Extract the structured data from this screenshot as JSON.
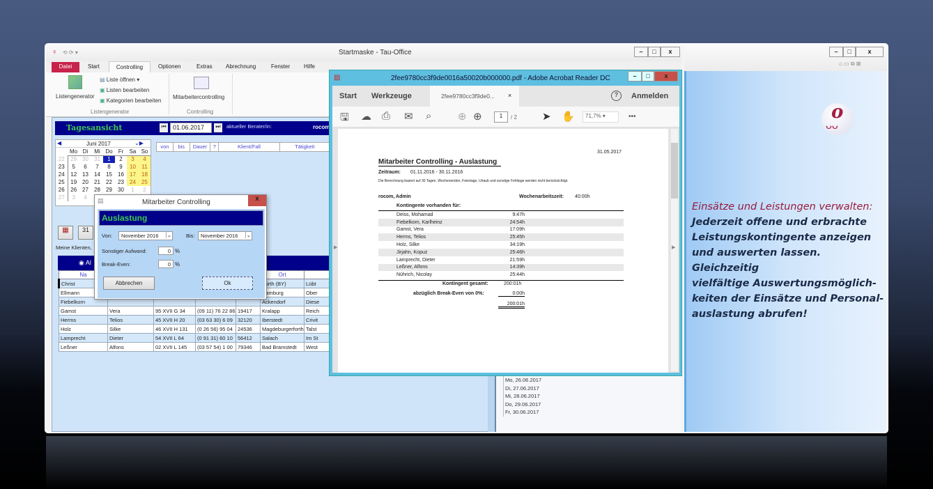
{
  "app": {
    "title": "Startmaske - Tau-Office",
    "quick_access": "⟲ ⟳ ▾",
    "tabs": [
      "Datei",
      "Start",
      "Controlling",
      "Optionen",
      "Extras",
      "Abrechnung",
      "Fenster",
      "Hilfe"
    ],
    "ribbon": {
      "listengenerator": "Listengenerator",
      "liste_oeffnen": "Liste öffnen ▾",
      "listen_bearbeiten": "Listen bearbeiten",
      "kategorien_bearbeiten": "Kategorien bearbeiten",
      "group1": "Listengenerator",
      "mitarbeitercontrolling": "Mitarbeitercontrolling",
      "group2": "Controlling"
    },
    "day_view": {
      "title": "Tagesansicht",
      "date": "01.06.2017",
      "berater_label": "aktueller Berater/in:",
      "berater": "rocom"
    },
    "calendar": {
      "month": "Juni 2017",
      "weekdays": [
        "Mo",
        "Di",
        "Mi",
        "Do",
        "Fr",
        "Sa",
        "So"
      ],
      "weeks": [
        [
          "22",
          "29",
          "30",
          "31",
          "1",
          "2",
          "3",
          "4"
        ],
        [
          "23",
          "5",
          "6",
          "7",
          "8",
          "9",
          "10",
          "11"
        ],
        [
          "24",
          "12",
          "13",
          "14",
          "15",
          "16",
          "17",
          "18"
        ],
        [
          "25",
          "19",
          "20",
          "21",
          "22",
          "23",
          "24",
          "25"
        ],
        [
          "26",
          "26",
          "27",
          "28",
          "29",
          "30",
          "1",
          "2"
        ],
        [
          "27",
          "3",
          "4",
          "5",
          "6",
          "7",
          "8",
          "9"
        ]
      ]
    },
    "schedule_columns": [
      "von",
      "bis",
      "Dauer",
      "?",
      "Klient/Fall",
      "Tätigkeit"
    ],
    "clients_label": "Meine Klienten,",
    "radio_label": "Al",
    "clients": {
      "columns": [
        "Na",
        "",
        "",
        "",
        "",
        "Ort",
        ""
      ],
      "rows": [
        [
          "Christ",
          "",
          "",
          "",
          "",
          "Fürth (BY)",
          "Lübt"
        ],
        [
          "Ellmann",
          "",
          "",
          "",
          "",
          "Hamburg",
          "Ober"
        ],
        [
          "Fiebelkorn",
          "",
          "",
          "",
          "",
          "Ackendorf",
          "Diese"
        ],
        [
          "Gamst",
          "Vera",
          "95 XVII G 34",
          "(09 11) 76 22 86",
          "19417",
          "Kralapp",
          "Reich"
        ],
        [
          "Herms",
          "Telios",
          "45 XVII H 20",
          "(03 63 30) 6 09",
          "32120",
          "Iberstedt",
          "Crivit"
        ],
        [
          "Holz",
          "Silke",
          "46 XVII H 131",
          "(0 26 56) 95 04",
          "24536",
          "Magdeburgerforth",
          "Talst"
        ],
        [
          "Lamprecht",
          "Dieter",
          "54 XVII L 64",
          "(0 91 31) 60 10",
          "56412",
          "Salach",
          "Im St"
        ],
        [
          "Leßner",
          "Alfons",
          "02 XVII L 145",
          "(03 57 54) 1 00",
          "79346",
          "Bad Bramstedt",
          "West"
        ]
      ]
    },
    "tree_dates": [
      "Mo, 26.06.2017",
      "Di, 27.06.2017",
      "Mi, 28.06.2017",
      "Do, 29.06.2017",
      "Fr, 30.06.2017"
    ]
  },
  "dialog": {
    "title": "Mitarbeiter Controlling",
    "header": "Auslastung",
    "von_label": "Von:",
    "von_value": "November 2016",
    "bis_label": "Bis:",
    "bis_value": "November 2016",
    "aufwand_label": "Sonstiger Aufwand:",
    "aufwand_value": "0",
    "break_label": "Break-Even:",
    "break_value": "0",
    "percent": "%",
    "cancel": "Abbrechen",
    "ok": "Ok"
  },
  "pdf": {
    "title": "2fee9780cc3f9de0016a50020b000000.pdf - Adobe Acrobat Reader DC",
    "nav_start": "Start",
    "nav_tools": "Werkzeuge",
    "doc_tab": "2fee9780cc3f9de0...",
    "signin": "Anmelden",
    "page_current": "1",
    "page_total": "/ 2",
    "zoom": "71,7%",
    "doc": {
      "date": "31.05.2017",
      "heading": "Mitarbeiter Controlling - Auslastung",
      "period_label": "Zeitraum:",
      "period": "01.11.2016 - 30.11.2016",
      "note": "Die Berechnung basiert auf 30 Tagen. Wochenenden, Feiertage, Urlaub und sonstige Fehltage werden nicht berücksichtigt.",
      "employee": "rocom, Admin",
      "weekly_label": "Wochenarbeitszeit:",
      "weekly": "40:00h",
      "contingent_heading": "Kontingente vorhanden für:",
      "rows": [
        [
          "Deiss, Mohamad",
          "9:47h"
        ],
        [
          "Fiebelkorn, Karlheinz",
          "24:54h"
        ],
        [
          "Gamst, Vera",
          "17:09h"
        ],
        [
          "Herms, Telios",
          "25:45h"
        ],
        [
          "Holz, Silke",
          "34:19h"
        ],
        [
          "Jirjahn, Kopuz",
          "25:46h"
        ],
        [
          "Lamprecht, Dieter",
          "21:59h"
        ],
        [
          "Leßner, Alfons",
          "14:39h"
        ],
        [
          "Nührich, Nicolay",
          "25:44h"
        ]
      ],
      "total_label": "Kontingent gesamt:",
      "total": "200:01h",
      "breakeven_label": "abzüglich Break-Even von 0%:",
      "breakeven": "0:00h",
      "result": "200:01h"
    }
  },
  "promo": {
    "headline": "Einsätze und Leistungen verwalten:",
    "body": [
      "Jederzeit offene und erbrachte",
      "Leistungskontingente anzeigen",
      "und auswerten lassen. Gleichzeitig",
      "vielfältige Auswertungsmöglich-",
      "keiten der Einsätze und Personal-",
      "auslastung abrufen!"
    ]
  },
  "colors": {
    "navy": "#00008a",
    "accent_green": "#3ec850",
    "datei": "#c8234a",
    "promo_headline": "#9a1a3a"
  }
}
